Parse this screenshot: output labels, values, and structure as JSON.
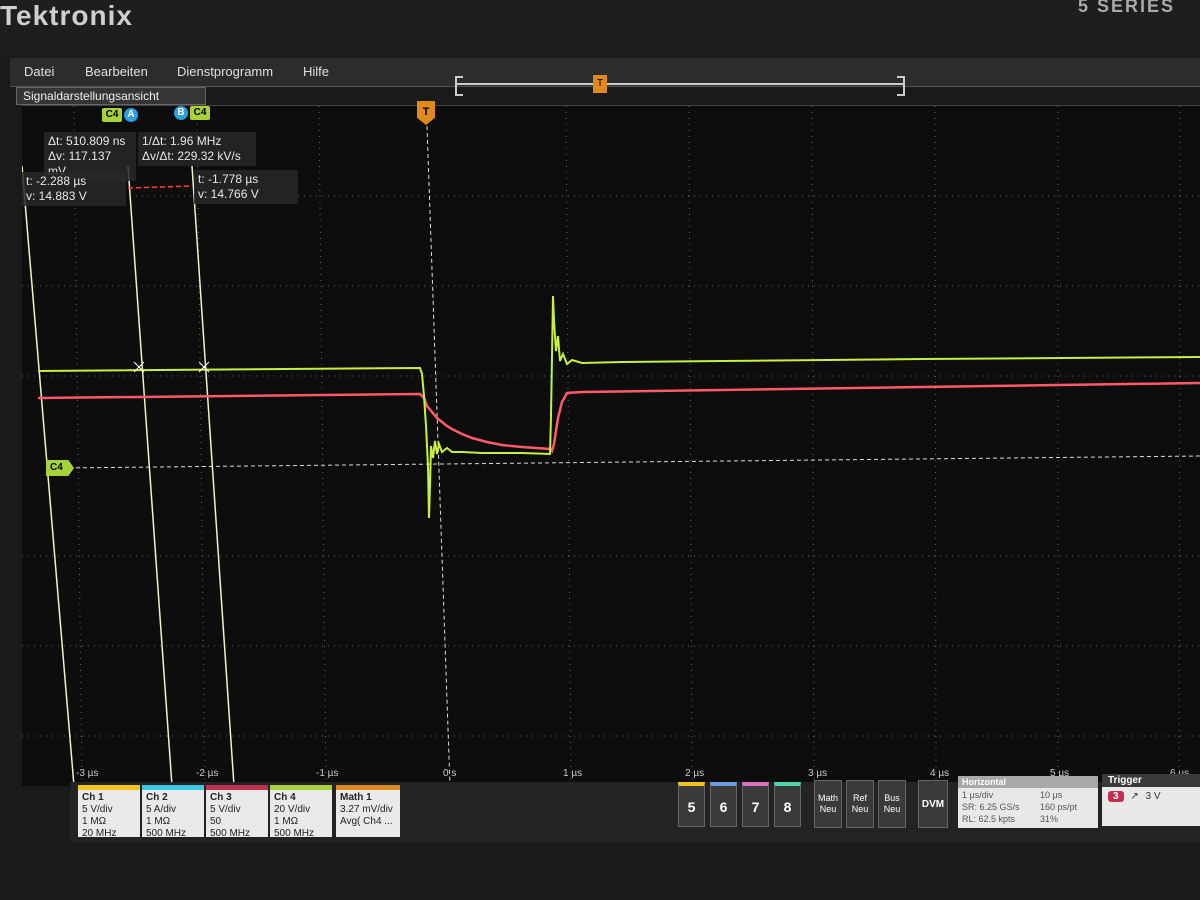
{
  "brand": "Tektronix",
  "series_label": "5 SERIES",
  "menu": [
    "Datei",
    "Bearbeiten",
    "Dienstprogramm",
    "Hilfe"
  ],
  "panel_title": "Signaldarstellungsansicht",
  "cursors": {
    "tag_c4": "C4",
    "tag_a": "A",
    "tag_b": "B",
    "delta_t": "Δt: 510.809 ns",
    "delta_v": "Δv: 117.137 mV",
    "inv_dt": "1/Δt: 1.96 MHz",
    "dv_dt": "Δv/Δt: 229.32 kV/s",
    "a_t": "t: -2.288 µs",
    "a_v": "v: 14.883 V",
    "b_t": "t: -1.778 µs",
    "b_v": "v: 14.766 V"
  },
  "trigger_marker": "T",
  "ch4_marker": "C4",
  "x_ticks": [
    "-3 µs",
    "-2 µs",
    "-1 µs",
    "0 s",
    "1 µs",
    "2 µs",
    "3 µs",
    "4 µs",
    "5 µs",
    "6 µs"
  ],
  "channels": [
    {
      "name": "Ch 1",
      "lines": [
        "5 V/div",
        "1 MΩ",
        "20 MHz"
      ],
      "color": "#f0c419"
    },
    {
      "name": "Ch 2",
      "lines": [
        "5 A/div",
        "1 MΩ",
        "500 MHz"
      ],
      "color": "#3cc8e0"
    },
    {
      "name": "Ch 3",
      "lines": [
        "5 V/div",
        "50",
        "500 MHz"
      ],
      "color": "#c03050"
    },
    {
      "name": "Ch 4",
      "lines": [
        "20 V/div",
        "1 MΩ",
        "500 MHz"
      ],
      "color": "#a8d23a"
    },
    {
      "name": "Math 1",
      "lines": [
        "3.27 mV/div",
        "Avg( Ch4 ..."
      ],
      "color": "#e08a1e"
    }
  ],
  "num_buttons": [
    "5",
    "6",
    "7",
    "8"
  ],
  "new_buttons": [
    {
      "top": "Math",
      "bottom": "Neu"
    },
    {
      "top": "Ref",
      "bottom": "Neu"
    },
    {
      "top": "Bus",
      "bottom": "Neu"
    }
  ],
  "dvm_label": "DVM",
  "horizontal": {
    "title": "Horizontal",
    "row1_left": "1 µs/div",
    "row1_right": "10 µs",
    "row2_left": "SR: 6.25 GS/s",
    "row2_right": "160 ps/pt",
    "row3_left": "RL: 62.5 kpts",
    "row3_right": "31%"
  },
  "trigger": {
    "title": "Trigger",
    "source": "3",
    "level": "3 V"
  },
  "colors": {
    "ch4_trace": "#c8f040",
    "math_trace": "#ff5a6a",
    "cursor": "#f2f2c8",
    "trigger": "#e08a1e"
  }
}
